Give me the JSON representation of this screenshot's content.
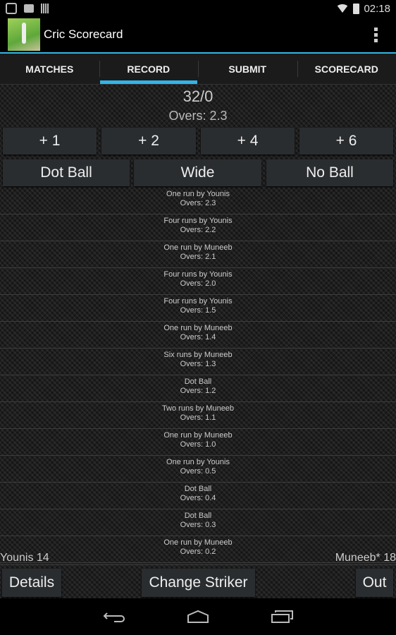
{
  "status_bar": {
    "time": "02:18",
    "icons": [
      "notification-app-icon",
      "outlook-icon",
      "barcode-icon",
      "wifi-icon",
      "battery-charging-icon"
    ]
  },
  "action_bar": {
    "title": "Cric Scorecard"
  },
  "tabs": [
    {
      "label": "MATCHES"
    },
    {
      "label": "RECORD",
      "active": true
    },
    {
      "label": "SUBMIT"
    },
    {
      "label": "SCORECARD"
    }
  ],
  "accent_color": "#33b5e5",
  "record": {
    "score": "32/0",
    "overs": "Overs: 2.3",
    "run_buttons": [
      "+ 1",
      "+ 2",
      "+ 4",
      "+ 6"
    ],
    "extra_buttons": [
      "Dot Ball",
      "Wide",
      "No Ball"
    ],
    "events": [
      {
        "text": "One run by Younis",
        "overs": "Overs: 2.3"
      },
      {
        "text": "Four runs by Younis",
        "overs": "Overs: 2.2"
      },
      {
        "text": "One run by Muneeb",
        "overs": "Overs: 2.1"
      },
      {
        "text": "Four runs by Younis",
        "overs": "Overs: 2.0"
      },
      {
        "text": "Four runs by Younis",
        "overs": "Overs: 1.5"
      },
      {
        "text": "One run by Muneeb",
        "overs": "Overs: 1.4"
      },
      {
        "text": "Six runs by Muneeb",
        "overs": "Overs: 1.3"
      },
      {
        "text": "Dot Ball",
        "overs": "Overs: 1.2"
      },
      {
        "text": "Two runs by Muneeb",
        "overs": "Overs: 1.1"
      },
      {
        "text": "One run by Muneeb",
        "overs": "Overs: 1.0"
      },
      {
        "text": "One run by Younis",
        "overs": "Overs: 0.5"
      },
      {
        "text": "Dot Ball",
        "overs": "Overs: 0.4"
      },
      {
        "text": "Dot Ball",
        "overs": "Overs: 0.3"
      },
      {
        "text": "One run by Muneeb",
        "overs": "Overs: 0.2"
      }
    ],
    "batsman_left": "Younis 14",
    "batsman_right": "Muneeb* 18",
    "details_label": "Details",
    "change_striker_label": "Change Striker",
    "out_label": "Out"
  }
}
